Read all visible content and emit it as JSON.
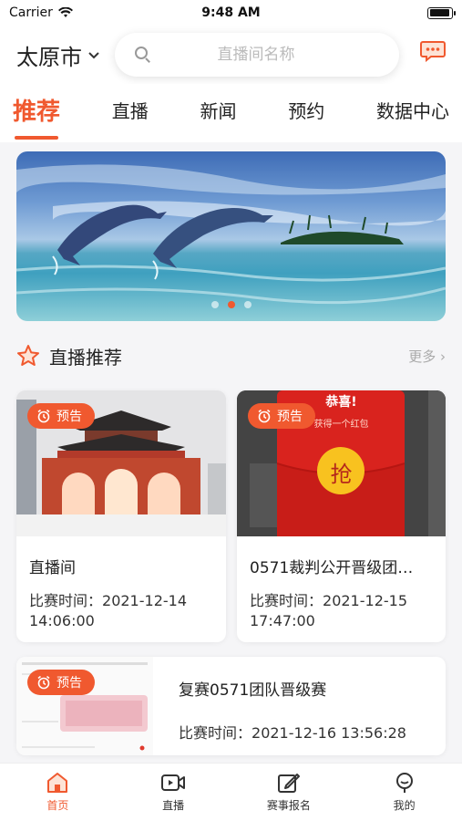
{
  "status_bar": {
    "carrier": "Carrier",
    "time": "9:48 AM"
  },
  "header": {
    "city": "太原市",
    "search_placeholder": "直播间名称"
  },
  "tabs": [
    {
      "label": "推荐",
      "active": true
    },
    {
      "label": "直播",
      "active": false
    },
    {
      "label": "新闻",
      "active": false
    },
    {
      "label": "预约",
      "active": false
    },
    {
      "label": "数据中心",
      "active": false
    }
  ],
  "banner": {
    "slide_count": 3,
    "active_slide": 2
  },
  "section": {
    "title": "直播推荐",
    "more": "更多 ›"
  },
  "cards": [
    {
      "badge": "预告",
      "title": "直播间",
      "time_label": "比赛时间：",
      "time": "2021-12-14 14:06:00"
    },
    {
      "badge": "预告",
      "title": "0571裁判公开晋级团…",
      "time_label": "比赛时间：",
      "time": "2021-12-15 17:47:00",
      "image_text_1": "恭喜!",
      "image_text_2": "获得一个红包",
      "image_text_3": "抢"
    }
  ],
  "wide_card": {
    "badge": "预告",
    "title": "复赛0571团队晋级赛",
    "time_label": "比赛时间：",
    "time": "2021-12-16 13:56:28"
  },
  "bottom_nav": [
    {
      "label": "首页",
      "icon": "home-icon",
      "active": true
    },
    {
      "label": "直播",
      "icon": "video-icon",
      "active": false
    },
    {
      "label": "赛事报名",
      "icon": "edit-icon",
      "active": false
    },
    {
      "label": "我的",
      "icon": "user-icon",
      "active": false
    }
  ],
  "colors": {
    "accent": "#f0592f",
    "background": "#f5f5f7"
  }
}
